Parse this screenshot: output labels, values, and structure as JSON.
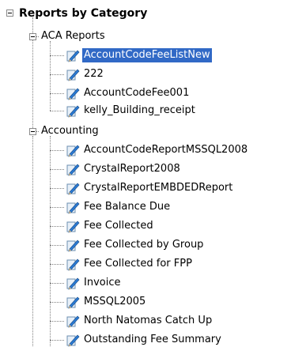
{
  "tree": {
    "root": {
      "label": "Reports by Category"
    },
    "groups": [
      {
        "label": "ACA Reports",
        "items": [
          {
            "label": "AccountCodeFeeListNew",
            "selected": true
          },
          {
            "label": "222"
          },
          {
            "label": "AccountCodeFee001"
          },
          {
            "label": "kelly_Building_receipt"
          }
        ]
      },
      {
        "label": "Accounting",
        "items": [
          {
            "label": "AccountCodeReportMSSQL2008"
          },
          {
            "label": "CrystalReport2008"
          },
          {
            "label": "CrystalReportEMBDEDReport"
          },
          {
            "label": "Fee Balance Due"
          },
          {
            "label": "Fee Collected"
          },
          {
            "label": "Fee Collected by Group"
          },
          {
            "label": "Fee Collected for FPP"
          },
          {
            "label": "Invoice"
          },
          {
            "label": "MSSQL2005"
          },
          {
            "label": "North Natomas Catch Up"
          },
          {
            "label": "Outstanding Fee Summary"
          }
        ]
      }
    ],
    "icon": "report-pencil-icon",
    "colors": {
      "selection": "#3169c6",
      "selected_text": "#ffffff",
      "tree_lines": "#808080"
    }
  }
}
